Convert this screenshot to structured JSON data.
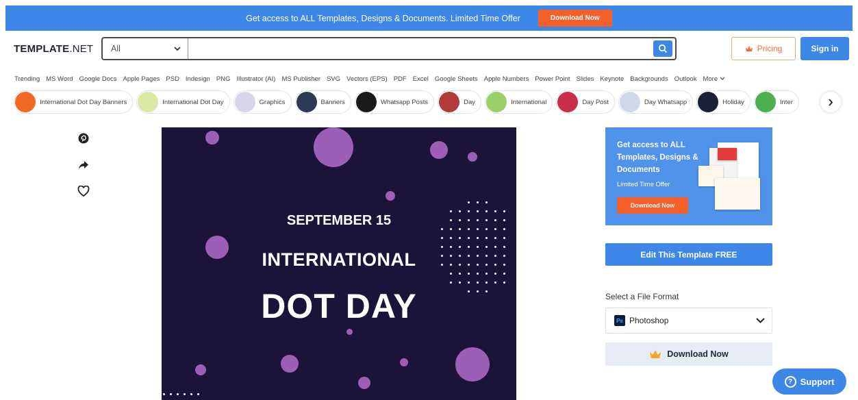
{
  "promo": {
    "text": "Get access to ALL Templates, Designs & Documents. Limited Time Offer",
    "button": "Download Now"
  },
  "header": {
    "logo_bold": "TEMPLATE",
    "logo_light": ".NET",
    "search_category": "All",
    "search_value": "",
    "pricing": "Pricing",
    "signin": "Sign in"
  },
  "categories": [
    "Trending",
    "MS Word",
    "Google Docs",
    "Apple Pages",
    "PSD",
    "Indesign",
    "PNG",
    "Illustrator (AI)",
    "MS Publisher",
    "SVG",
    "Vectors (EPS)",
    "PDF",
    "Excel",
    "Google Sheets",
    "Apple Numbers",
    "Power Point",
    "Slides",
    "Keynote",
    "Backgrounds",
    "Outlook",
    "More"
  ],
  "chips": [
    {
      "label": "International Dot Day Banners",
      "color": "#f26a21"
    },
    {
      "label": "International Dot Day",
      "color": "#d9e8a4"
    },
    {
      "label": "Graphics",
      "color": "#d6d6e6"
    },
    {
      "label": "Banners",
      "color": "#2c3a55"
    },
    {
      "label": "Whatsapp Posts",
      "color": "#1a1a1a"
    },
    {
      "label": "Day",
      "color": "#b23a3a"
    },
    {
      "label": "International",
      "color": "#9bcf6a"
    },
    {
      "label": "Day Post",
      "color": "#c8304a"
    },
    {
      "label": "Day Whatsapp",
      "color": "#cfd8e6"
    },
    {
      "label": "Holiday",
      "color": "#1b2238"
    },
    {
      "label": "Inter",
      "color": "#4caf50"
    }
  ],
  "preview": {
    "date": "SEPTEMBER 15",
    "line1": "INTERNATIONAL",
    "line2": "DOT DAY",
    "bg_color": "#1c1338",
    "dot_color": "#9c5fb5"
  },
  "ad": {
    "text": "Get access to ALL Templates, Designs & Documents",
    "subtext": "Limited Time Offer",
    "button": "Download Now"
  },
  "edit_button": "Edit This Template FREE",
  "format": {
    "label": "Select a File Format",
    "selected": "Photoshop",
    "icon_text": "Ps"
  },
  "download_button": "Download Now",
  "support": "Support",
  "colors": {
    "accent": "#3d87e8",
    "orange": "#f3602a"
  }
}
